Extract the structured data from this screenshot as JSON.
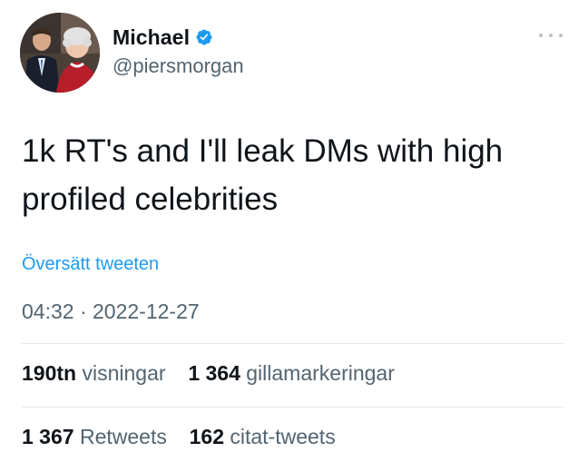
{
  "author": {
    "display_name": "Michael",
    "handle": "@piersmorgan",
    "verified": true,
    "verified_color": "#1d9bf0"
  },
  "tweet": {
    "text": "1k RT's and I'll leak DMs with high profiled celebrities",
    "translate_label": "Översätt tweeten",
    "time": "04:32",
    "separator": "·",
    "date": "2022-12-27"
  },
  "stats": {
    "views_count": "190tn",
    "views_label": "visningar",
    "likes_count": "1 364",
    "likes_label": "gillamarkeringar",
    "retweets_count": "1 367",
    "retweets_label": "Retweets",
    "quotes_count": "162",
    "quotes_label": "citat-tweets"
  },
  "icons": {
    "verified": "verified-badge-icon",
    "more": "more-options-icon"
  }
}
